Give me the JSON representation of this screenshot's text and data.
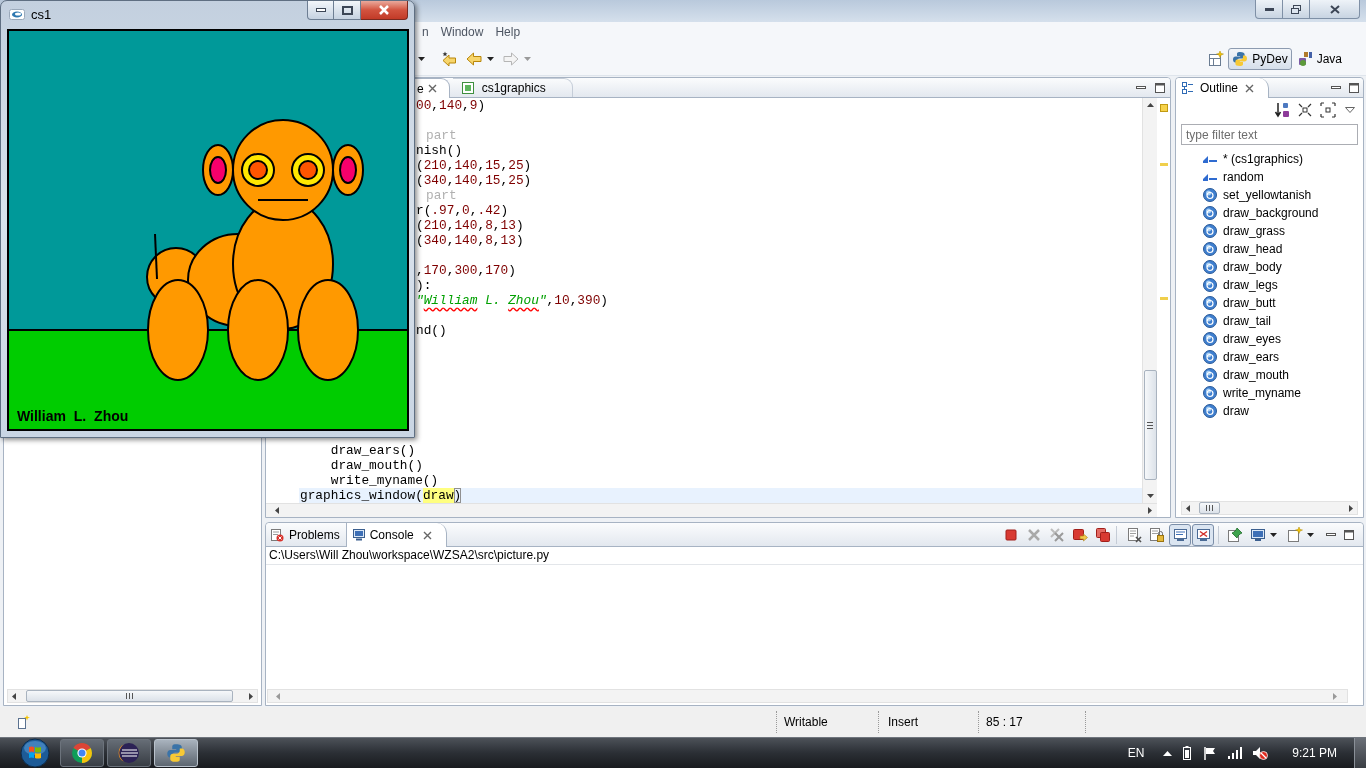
{
  "eclipse": {
    "menu": [
      {
        "label": "n"
      },
      {
        "label": "Window"
      },
      {
        "label": "Help"
      }
    ],
    "perspectives": [
      {
        "kind": "python",
        "label": "PyDev",
        "selected": true
      },
      {
        "kind": "java",
        "label": "Java",
        "selected": false
      }
    ],
    "editor": {
      "tabs": [
        {
          "label": "e",
          "selected": true
        },
        {
          "label": "cs1graphics",
          "selected": false
        }
      ],
      "lines": [
        {
          "current": false,
          "tokens": [
            {
              "text": "00",
              "kind": "number"
            },
            {
              "text": ",",
              "kind": "plain"
            },
            {
              "text": "140",
              "kind": "number"
            },
            {
              "text": ",",
              "kind": "plain"
            },
            {
              "text": "9",
              "kind": "number"
            },
            {
              "text": ")",
              "kind": "plain"
            }
          ]
        },
        {
          "current": false,
          "tokens": [
            {
              "text": "part",
              "kind": "comment"
            }
          ]
        },
        {
          "current": false,
          "tokens": [
            {
              "text": "nish()",
              "kind": "plain"
            }
          ]
        },
        {
          "current": false,
          "tokens": [
            {
              "text": "(",
              "kind": "plain"
            },
            {
              "text": "210",
              "kind": "number"
            },
            {
              "text": ",",
              "kind": "plain"
            },
            {
              "text": "140",
              "kind": "number"
            },
            {
              "text": ",",
              "kind": "plain"
            },
            {
              "text": "15",
              "kind": "number"
            },
            {
              "text": ",",
              "kind": "plain"
            },
            {
              "text": "25",
              "kind": "number"
            },
            {
              "text": ")",
              "kind": "plain"
            }
          ]
        },
        {
          "current": false,
          "tokens": [
            {
              "text": "(",
              "kind": "plain"
            },
            {
              "text": "340",
              "kind": "number"
            },
            {
              "text": ",",
              "kind": "plain"
            },
            {
              "text": "140",
              "kind": "number"
            },
            {
              "text": ",",
              "kind": "plain"
            },
            {
              "text": "15",
              "kind": "number"
            },
            {
              "text": ",",
              "kind": "plain"
            },
            {
              "text": "25",
              "kind": "number"
            },
            {
              "text": ")",
              "kind": "plain"
            }
          ]
        },
        {
          "current": false,
          "tokens": [
            {
              "text": "part",
              "kind": "comment"
            }
          ]
        },
        {
          "current": false,
          "tokens": [
            {
              "text": "r(",
              "kind": "plain"
            },
            {
              "text": ".97",
              "kind": "number"
            },
            {
              "text": ",",
              "kind": "plain"
            },
            {
              "text": "0",
              "kind": "number"
            },
            {
              "text": ",",
              "kind": "plain"
            },
            {
              "text": ".42",
              "kind": "number"
            },
            {
              "text": ")",
              "kind": "plain"
            }
          ]
        },
        {
          "current": false,
          "tokens": [
            {
              "text": "(",
              "kind": "plain"
            },
            {
              "text": "210",
              "kind": "number"
            },
            {
              "text": ",",
              "kind": "plain"
            },
            {
              "text": "140",
              "kind": "number"
            },
            {
              "text": ",",
              "kind": "plain"
            },
            {
              "text": "8",
              "kind": "number"
            },
            {
              "text": ",",
              "kind": "plain"
            },
            {
              "text": "13",
              "kind": "number"
            },
            {
              "text": ")",
              "kind": "plain"
            }
          ]
        },
        {
          "current": false,
          "tokens": [
            {
              "text": "(",
              "kind": "plain"
            },
            {
              "text": "340",
              "kind": "number"
            },
            {
              "text": ",",
              "kind": "plain"
            },
            {
              "text": "140",
              "kind": "number"
            },
            {
              "text": ",",
              "kind": "plain"
            },
            {
              "text": "8",
              "kind": "number"
            },
            {
              "text": ",",
              "kind": "plain"
            },
            {
              "text": "13",
              "kind": "number"
            },
            {
              "text": ")",
              "kind": "plain"
            }
          ]
        },
        {
          "current": false,
          "tokens": [
            {
              "text": ",",
              "kind": "plain"
            },
            {
              "text": "170",
              "kind": "number"
            },
            {
              "text": ",",
              "kind": "plain"
            },
            {
              "text": "300",
              "kind": "number"
            },
            {
              "text": ",",
              "kind": "plain"
            },
            {
              "text": "170",
              "kind": "number"
            },
            {
              "text": ")",
              "kind": "plain"
            }
          ]
        },
        {
          "current": false,
          "tokens": [
            {
              "text": "):",
              "kind": "plain"
            }
          ]
        },
        {
          "current": false,
          "tokens": [
            {
              "text": "\"",
              "kind": "string",
              "misspelled": false
            },
            {
              "text": "William",
              "kind": "string",
              "misspelled": true
            },
            {
              "text": " L. ",
              "kind": "string",
              "misspelled": false
            },
            {
              "text": "Zhou",
              "kind": "string",
              "misspelled": true
            },
            {
              "text": "\"",
              "kind": "string",
              "misspelled": false
            },
            {
              "text": ",",
              "kind": "plain"
            },
            {
              "text": "10",
              "kind": "number"
            },
            {
              "text": ",",
              "kind": "plain"
            },
            {
              "text": "390",
              "kind": "number"
            },
            {
              "text": ")",
              "kind": "plain"
            }
          ]
        },
        {
          "current": false,
          "tokens": [
            {
              "text": "nd()",
              "kind": "plain"
            }
          ]
        },
        {
          "current": false,
          "tokens": [
            {
              "text": "    draw_ears()",
              "kind": "plain"
            }
          ]
        },
        {
          "current": false,
          "tokens": [
            {
              "text": "    draw_mouth()",
              "kind": "plain"
            }
          ]
        },
        {
          "current": false,
          "tokens": [
            {
              "text": "    write_myname()",
              "kind": "plain"
            }
          ]
        },
        {
          "current": true,
          "tokens": [
            {
              "text": "graphics_window(",
              "kind": "plain"
            },
            {
              "text": "draw",
              "kind": "occurrence"
            },
            {
              "text": ")",
              "kind": "bracket"
            }
          ]
        }
      ]
    },
    "outline": {
      "tab": {
        "label": "Outline",
        "selected": true
      },
      "filter": {
        "placeholder": "type filter text"
      },
      "items": [
        {
          "kind": "import",
          "label": "* (cs1graphics)"
        },
        {
          "kind": "import",
          "label": "random"
        },
        {
          "kind": "function",
          "label": "set_yellowtanish"
        },
        {
          "kind": "function",
          "label": "draw_background"
        },
        {
          "kind": "function",
          "label": "draw_grass"
        },
        {
          "kind": "function",
          "label": "draw_head"
        },
        {
          "kind": "function",
          "label": "draw_body"
        },
        {
          "kind": "function",
          "label": "draw_legs"
        },
        {
          "kind": "function",
          "label": "draw_butt"
        },
        {
          "kind": "function",
          "label": "draw_tail"
        },
        {
          "kind": "function",
          "label": "draw_eyes"
        },
        {
          "kind": "function",
          "label": "draw_ears"
        },
        {
          "kind": "function",
          "label": "draw_mouth"
        },
        {
          "kind": "function",
          "label": "write_myname"
        },
        {
          "kind": "function",
          "label": "draw"
        }
      ]
    },
    "console": {
      "tabs": [
        {
          "kind": "problems",
          "label": "Problems",
          "selected": false
        },
        {
          "kind": "console",
          "label": "Console",
          "selected": true
        }
      ],
      "path": "C:\\Users\\Will Zhou\\workspace\\WZSA2\\src\\picture.py"
    },
    "status_bar": [
      {
        "label": "Writable"
      },
      {
        "label": "Insert"
      },
      {
        "label": "85 : 17"
      }
    ]
  },
  "graphics_window": {
    "title": "cs1",
    "signature": "William L. Zhou"
  },
  "taskbar": {
    "apps": [
      {
        "kind": "browser",
        "selected": false
      },
      {
        "kind": "ide",
        "selected": false
      },
      {
        "kind": "python",
        "selected": true
      }
    ],
    "tray": {
      "language": "EN",
      "clock": "9:21 PM"
    }
  }
}
